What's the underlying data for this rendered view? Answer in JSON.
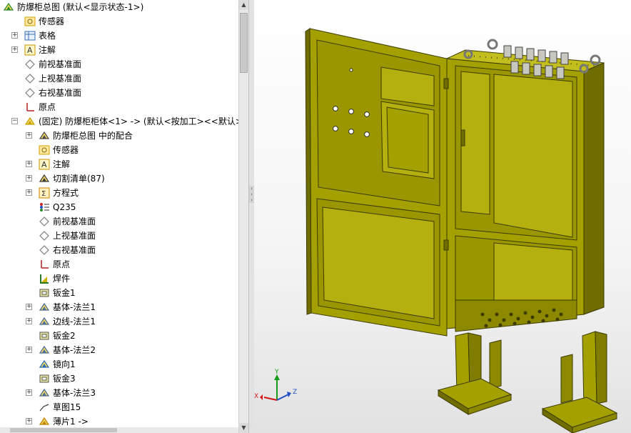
{
  "feature_tree": {
    "items": [
      {
        "label": "防爆柜总图  (默认<显示状态-1>)",
        "icon": "assembly-icon",
        "level": 0,
        "expand": ""
      },
      {
        "label": "传感器",
        "icon": "sensor-icon",
        "level": 1,
        "expand": ""
      },
      {
        "label": "表格",
        "icon": "table-icon",
        "level": 1,
        "expand": "+"
      },
      {
        "label": "注解",
        "icon": "annotation-icon",
        "level": 1,
        "expand": "+"
      },
      {
        "label": "前视基准面",
        "icon": "plane-icon",
        "level": 1,
        "expand": ""
      },
      {
        "label": "上视基准面",
        "icon": "plane-icon",
        "level": 1,
        "expand": ""
      },
      {
        "label": "右视基准面",
        "icon": "plane-icon",
        "level": 1,
        "expand": ""
      },
      {
        "label": "原点",
        "icon": "origin-icon",
        "level": 1,
        "expand": ""
      },
      {
        "label": "(固定) 防爆柜柜体<1> -> (默认<按加工><<默认>_显",
        "icon": "part-icon",
        "level": 1,
        "expand": "−"
      },
      {
        "label": "防爆柜总图 中的配合",
        "icon": "mates-icon",
        "level": 2,
        "expand": "+"
      },
      {
        "label": "传感器",
        "icon": "sensor-icon",
        "level": 2,
        "expand": ""
      },
      {
        "label": "注解",
        "icon": "annotation-icon",
        "level": 2,
        "expand": "+"
      },
      {
        "label": "切割清单(87)",
        "icon": "cutlist-icon",
        "level": 2,
        "expand": "+"
      },
      {
        "label": "方程式",
        "icon": "equation-icon",
        "level": 2,
        "expand": "+"
      },
      {
        "label": "Q235",
        "icon": "material-icon",
        "level": 2,
        "expand": ""
      },
      {
        "label": "前视基准面",
        "icon": "plane-icon",
        "level": 2,
        "expand": ""
      },
      {
        "label": "上视基准面",
        "icon": "plane-icon",
        "level": 2,
        "expand": ""
      },
      {
        "label": "右视基准面",
        "icon": "plane-icon",
        "level": 2,
        "expand": ""
      },
      {
        "label": "原点",
        "icon": "origin-icon",
        "level": 2,
        "expand": ""
      },
      {
        "label": "焊件",
        "icon": "weldment-icon",
        "level": 2,
        "expand": ""
      },
      {
        "label": "钣金1",
        "icon": "sheetmetal-icon",
        "level": 2,
        "expand": ""
      },
      {
        "label": "基体-法兰1",
        "icon": "base-flange-icon",
        "level": 2,
        "expand": "+"
      },
      {
        "label": "边线-法兰1",
        "icon": "edge-flange-icon",
        "level": 2,
        "expand": "+"
      },
      {
        "label": "钣金2",
        "icon": "sheetmetal-icon",
        "level": 2,
        "expand": ""
      },
      {
        "label": "基体-法兰2",
        "icon": "base-flange-icon",
        "level": 2,
        "expand": "+"
      },
      {
        "label": "镜向1",
        "icon": "mirror-icon",
        "level": 2,
        "expand": ""
      },
      {
        "label": "钣金3",
        "icon": "sheetmetal-icon",
        "level": 2,
        "expand": ""
      },
      {
        "label": "基体-法兰3",
        "icon": "base-flange-icon",
        "level": 2,
        "expand": "+"
      },
      {
        "label": "草图15",
        "icon": "sketch-icon",
        "level": 2,
        "expand": ""
      },
      {
        "label": "薄片1 ->",
        "icon": "tab-icon",
        "level": 2,
        "expand": "+"
      }
    ]
  },
  "triad": {
    "x": "X",
    "y": "Y",
    "z": "Z"
  },
  "colors": {
    "model": "#a3a000",
    "model_dark": "#6f6c00",
    "model_light": "#c2be1e"
  }
}
